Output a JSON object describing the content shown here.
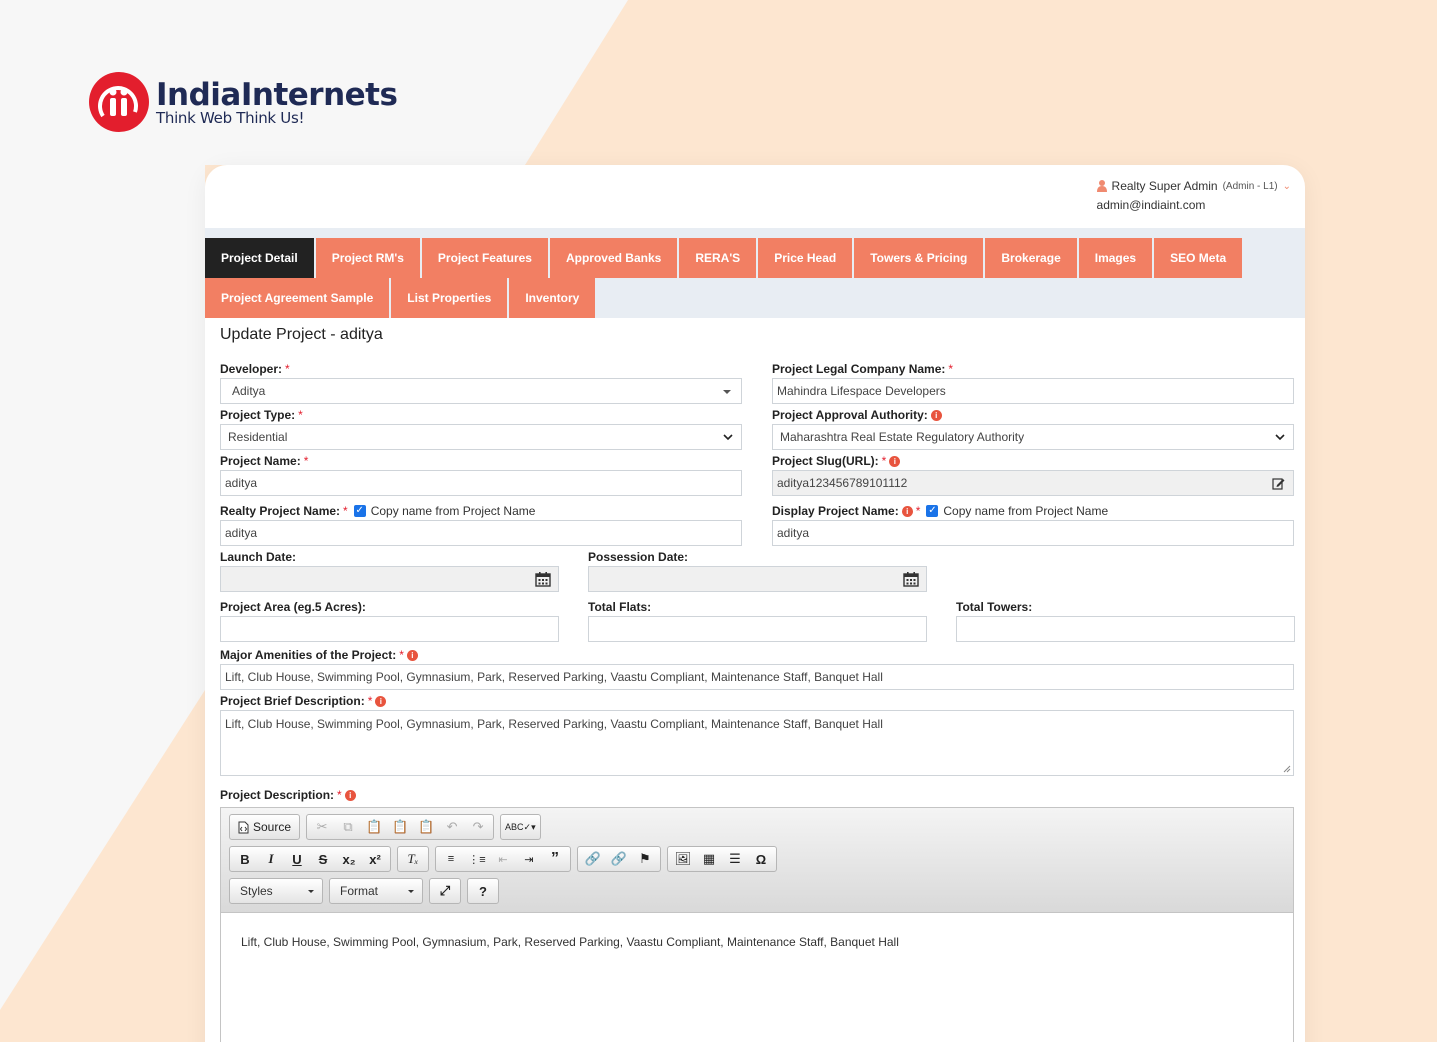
{
  "brand": {
    "name": "IndiaInternets",
    "tagline": "Think Web Think Us!"
  },
  "user": {
    "name": "Realty Super Admin",
    "role": "(Admin - L1)",
    "email": "admin@indiaint.com"
  },
  "tabs_row1": [
    {
      "label": "Project Detail",
      "active": true
    },
    {
      "label": "Project RM's"
    },
    {
      "label": "Project Features"
    },
    {
      "label": "Approved Banks"
    },
    {
      "label": "RERA'S"
    },
    {
      "label": "Price Head"
    },
    {
      "label": "Towers & Pricing"
    },
    {
      "label": "Brokerage"
    },
    {
      "label": "Images"
    },
    {
      "label": "SEO Meta"
    }
  ],
  "tabs_row2": [
    {
      "label": "Project Agreement Sample"
    },
    {
      "label": "List Properties"
    },
    {
      "label": "Inventory"
    }
  ],
  "form": {
    "title": "Update Project - aditya",
    "developer": {
      "label": "Developer:",
      "value": "Aditya"
    },
    "legal_company": {
      "label": "Project Legal Company Name:",
      "value": "Mahindra Lifespace Developers"
    },
    "project_type": {
      "label": "Project Type:",
      "value": "Residential"
    },
    "approval_authority": {
      "label": "Project Approval Authority:",
      "value": "Maharashtra Real Estate Regulatory Authority"
    },
    "project_name": {
      "label": "Project Name:",
      "value": "aditya"
    },
    "project_slug": {
      "label": "Project Slug(URL):",
      "value": "aditya123456789101112"
    },
    "realty_project_name": {
      "label": "Realty Project Name:",
      "copy_label": "Copy name from Project Name",
      "value": "aditya"
    },
    "display_project_name": {
      "label": "Display Project Name:",
      "copy_label": "Copy name from Project Name",
      "value": "aditya"
    },
    "launch_date": {
      "label": "Launch Date:",
      "value": ""
    },
    "possession_date": {
      "label": "Possession Date:",
      "value": ""
    },
    "project_area": {
      "label": "Project Area (eg.5 Acres):",
      "value": ""
    },
    "total_flats": {
      "label": "Total Flats:",
      "value": ""
    },
    "total_towers": {
      "label": "Total Towers:",
      "value": ""
    },
    "amenities": {
      "label": "Major Amenities of the Project:",
      "value": "Lift, Club House, Swimming Pool, Gymnasium, Park, Reserved Parking, Vaastu Compliant, Maintenance Staff, Banquet Hall"
    },
    "brief_description": {
      "label": "Project Brief Description:",
      "value": "Lift, Club House, Swimming Pool, Gymnasium, Park, Reserved Parking, Vaastu Compliant, Maintenance Staff, Banquet Hall"
    },
    "description": {
      "label": "Project Description:",
      "value": "Lift, Club House, Swimming Pool, Gymnasium, Park, Reserved Parking, Vaastu Compliant, Maintenance Staff, Banquet Hall"
    },
    "required_mark": "*",
    "info_mark": "i"
  },
  "editor": {
    "source_label": "Source",
    "styles_label": "Styles",
    "format_label": "Format"
  },
  "colors": {
    "tab": "#f27f63",
    "tab_active": "#222222",
    "brand_red": "#e31e2d",
    "brand_navy": "#1f2a55",
    "background_peach": "#fde6d0"
  }
}
